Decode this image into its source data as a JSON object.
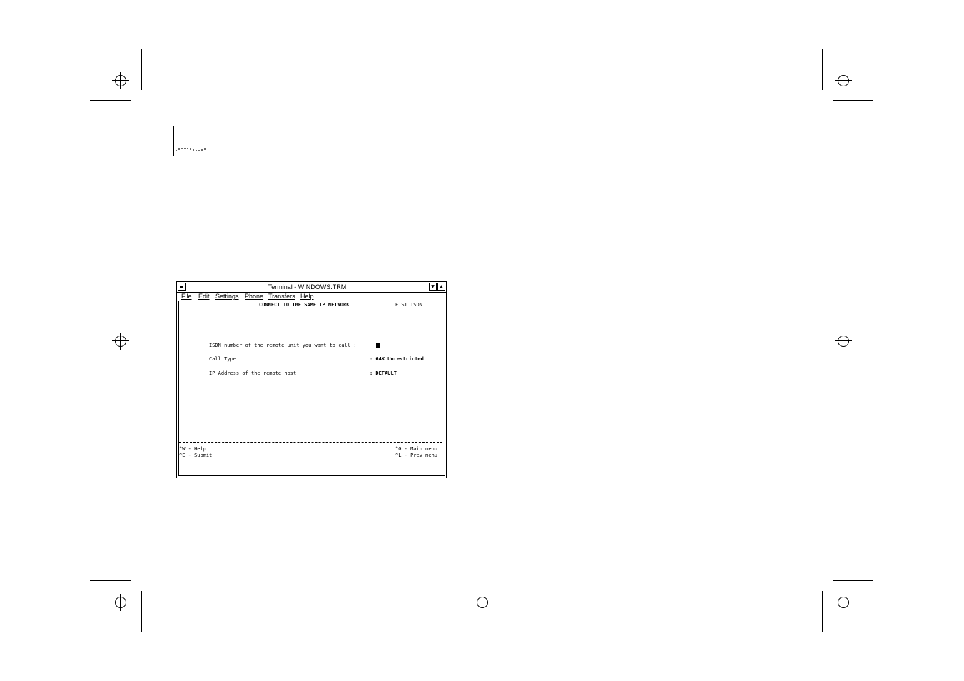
{
  "window": {
    "title": "Terminal - WINDOWS.TRM",
    "menu": [
      "File",
      "Edit",
      "Settings",
      "Phone",
      "Transfers",
      "Help"
    ]
  },
  "screen": {
    "header_title": "CONNECT TO THE SAME IP NETWORK",
    "header_mode": "ETSI ISDN",
    "fields": [
      {
        "label": "ISDN number of the remote unit you want to call :",
        "value": ""
      },
      {
        "label": "Call Type",
        "value": ": 64K Unrestricted"
      },
      {
        "label": "IP Address of the remote host",
        "value": ": DEFAULT"
      }
    ],
    "footer": {
      "help": "^W - Help",
      "submit": "^E - Submit",
      "main_menu": "^G - Main menu",
      "prev_menu": "^L - Prev menu"
    }
  }
}
